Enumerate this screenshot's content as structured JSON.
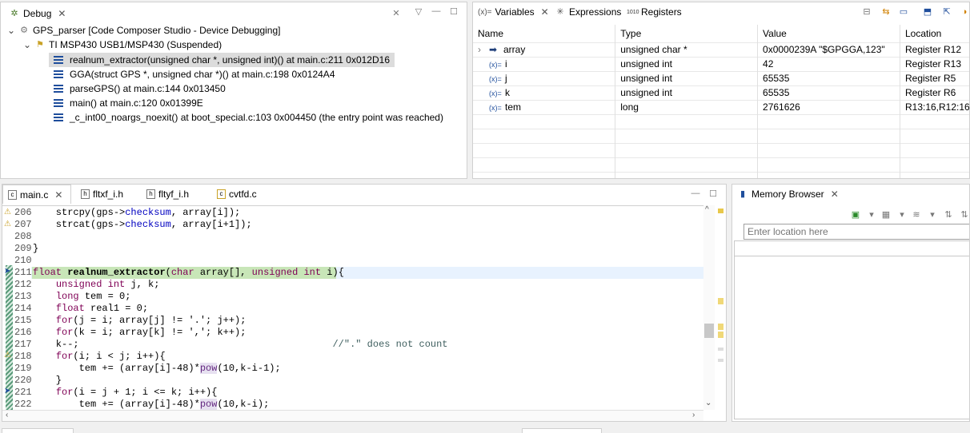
{
  "debug": {
    "tab_label": "Debug",
    "session": "GPS_parser [Code Composer Studio - Device Debugging]",
    "target": "TI MSP430 USB1/MSP430 (Suspended)",
    "frames": [
      "realnum_extractor(unsigned char *, unsigned int)() at main.c:211 0x012D16",
      "GGA(struct GPS *, unsigned char *)() at main.c:198 0x0124A4",
      "parseGPS() at main.c:144 0x013450",
      "main() at main.c:120 0x01399E",
      "_c_int00_noargs_noexit() at boot_special.c:103 0x004450  (the entry point was reached)"
    ]
  },
  "vars_panel": {
    "tabs": [
      "Variables",
      "Expressions",
      "Registers"
    ],
    "tab_prefixes": [
      "(x)=",
      "",
      "1010"
    ],
    "columns": [
      "Name",
      "Type",
      "Value",
      "Location"
    ],
    "rows": [
      {
        "name": "array",
        "type": "unsigned char *",
        "value": "0x0000239A \"$GPGGA,123\"",
        "location": "Register R12"
      },
      {
        "name": "i",
        "type": "unsigned int",
        "value": "42",
        "location": "Register R13"
      },
      {
        "name": "j",
        "type": "unsigned int",
        "value": "65535",
        "location": "Register R5"
      },
      {
        "name": "k",
        "type": "unsigned int",
        "value": "65535",
        "location": "Register R6"
      },
      {
        "name": "tem",
        "type": "long",
        "value": "2761626",
        "location": "R13:16,R12:16"
      }
    ]
  },
  "editor": {
    "tabs": [
      "main.c",
      "fltxf_i.h",
      "fltyf_i.h",
      "cvtfd.c"
    ],
    "lines": [
      {
        "n": "206",
        "text": "    strcpy(gps->checksum, array[i]);"
      },
      {
        "n": "207",
        "text": "    strcat(gps->checksum, array[i+1]);"
      },
      {
        "n": "208",
        "text": ""
      },
      {
        "n": "209",
        "text": "}"
      },
      {
        "n": "210",
        "text": ""
      },
      {
        "n": "211",
        "text": "float realnum_extractor(char array[], unsigned int i){"
      },
      {
        "n": "212",
        "text": "    unsigned int j, k;"
      },
      {
        "n": "213",
        "text": "    long tem = 0;"
      },
      {
        "n": "214",
        "text": "    float real1 = 0;"
      },
      {
        "n": "215",
        "text": "    for(j = i; array[j] != '.'; j++);"
      },
      {
        "n": "216",
        "text": "    for(k = i; array[k] != ','; k++);"
      },
      {
        "n": "217",
        "text": "    k--;                                            //\".\" does not count"
      },
      {
        "n": "218",
        "text": "    for(i; i < j; i++){"
      },
      {
        "n": "219",
        "text": "        tem += (array[i]-48)*pow(10,k-i-1);"
      },
      {
        "n": "220",
        "text": "    }"
      },
      {
        "n": "221",
        "text": "    for(i = j + 1; i <= k; i++){"
      },
      {
        "n": "222",
        "text": "        tem += (array[i]-48)*pow(10,k-i);"
      }
    ]
  },
  "memory": {
    "tab_label": "Memory Browser",
    "location_placeholder": "Enter location here"
  },
  "colors": {
    "keyword": "#7f0055",
    "current_line": "#e8f2fe",
    "highlight_frame": "#dcdcdc"
  }
}
